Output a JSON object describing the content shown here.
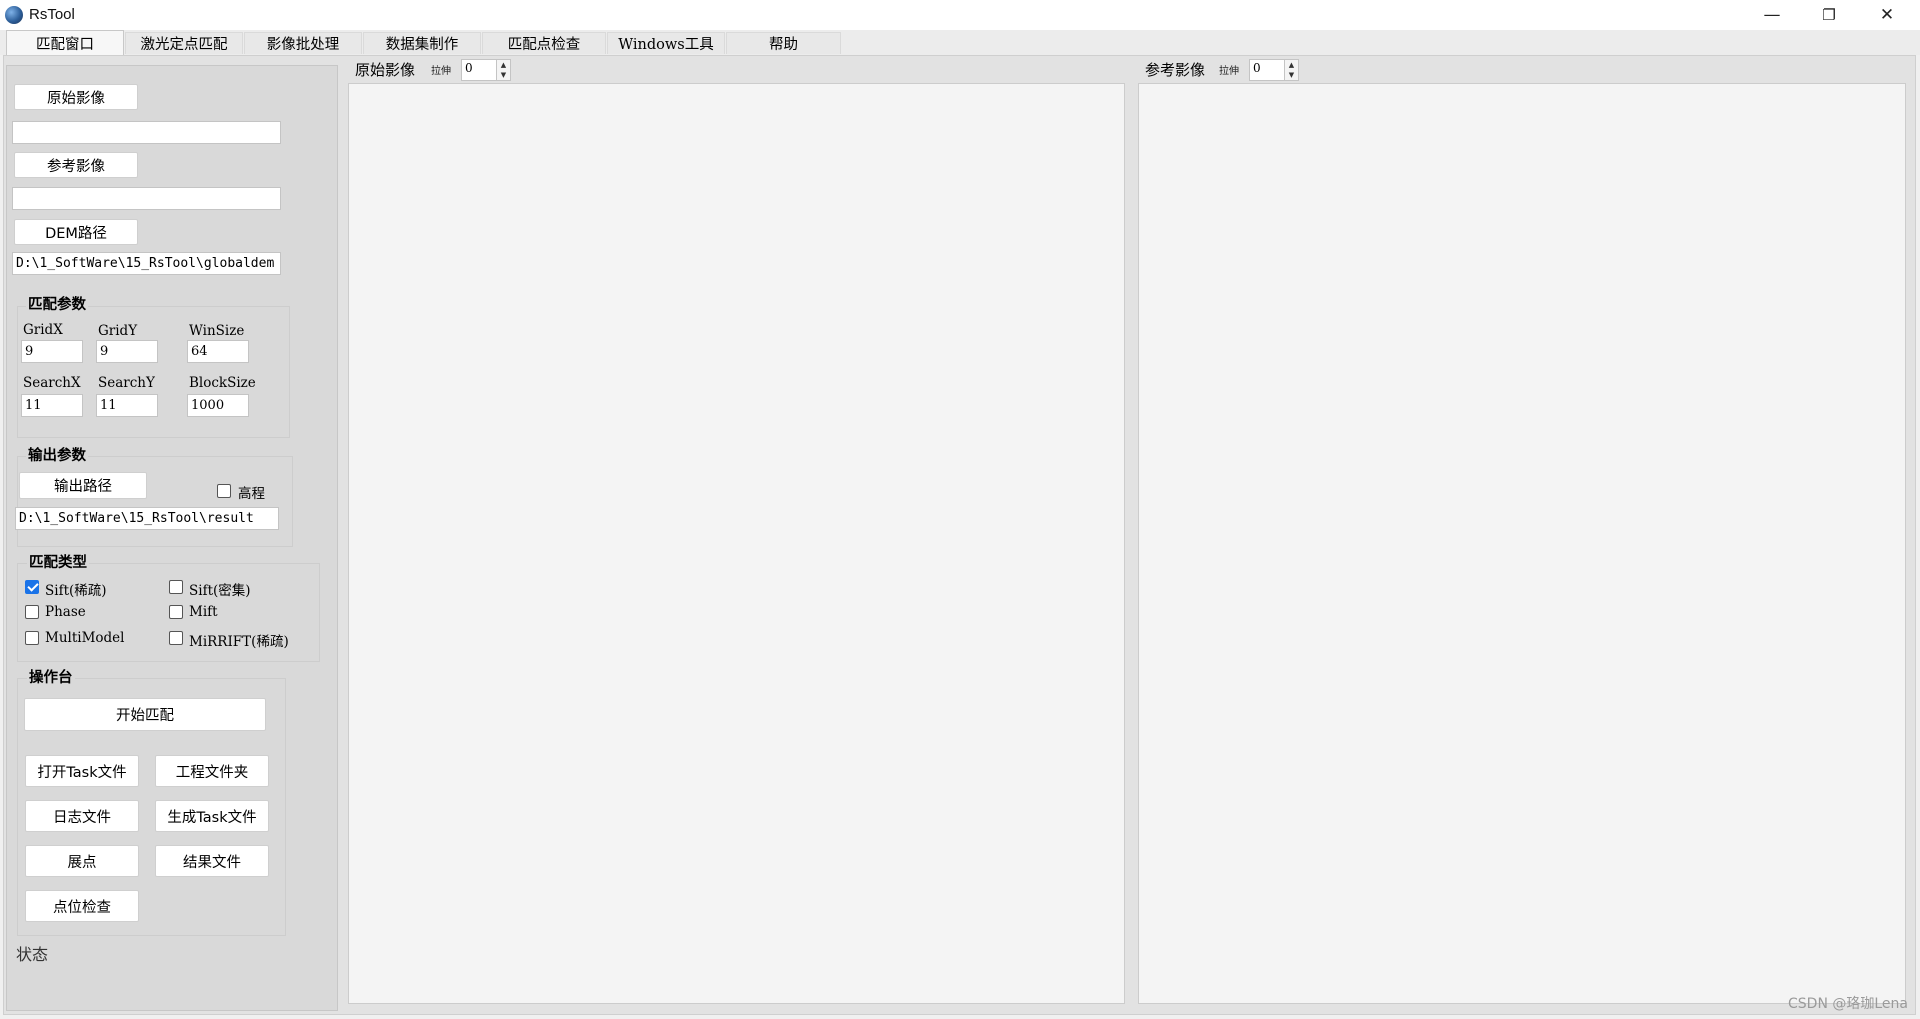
{
  "window": {
    "title": "RsTool",
    "controls": {
      "minimize": "—",
      "restore": "❐",
      "close": "✕"
    }
  },
  "tabs": [
    {
      "label": "匹配窗口",
      "active": true
    },
    {
      "label": "激光定点匹配"
    },
    {
      "label": "影像批处理"
    },
    {
      "label": "数据集制作"
    },
    {
      "label": "匹配点检查"
    },
    {
      "label": "Windows工具"
    },
    {
      "label": "帮助"
    }
  ],
  "input": {
    "src_button": "原始影像",
    "src_path": "",
    "ref_button": "参考影像",
    "ref_path": "",
    "dem_button": "DEM路径",
    "dem_path": "D:\\1_SoftWare\\15_RsTool\\globaldem"
  },
  "match_params": {
    "title": "匹配参数",
    "gridx_label": "GridX",
    "gridx": "9",
    "gridy_label": "GridY",
    "gridy": "9",
    "winsize_label": "WinSize",
    "winsize": "64",
    "searchx_label": "SearchX",
    "searchx": "11",
    "searchy_label": "SearchY",
    "searchy": "11",
    "blocksize_label": "BlockSize",
    "blocksize": "1000"
  },
  "output_params": {
    "title": "输出参数",
    "path_button": "输出路径",
    "elevation_label": "高程",
    "elevation_checked": false,
    "path": "D:\\1_SoftWare\\15_RsTool\\result"
  },
  "match_type": {
    "title": "匹配类型",
    "options": [
      {
        "label": "Sift(稀疏)",
        "checked": true
      },
      {
        "label": "Sift(密集)",
        "checked": false
      },
      {
        "label": "Phase",
        "checked": false
      },
      {
        "label": "Mift",
        "checked": false
      },
      {
        "label": "MultiModel",
        "checked": false
      },
      {
        "label": "MiRRIFT(稀疏)",
        "checked": false
      }
    ]
  },
  "console": {
    "title": "操作台",
    "start": "开始匹配",
    "open_task": "打开Task文件",
    "project_folder": "工程文件夹",
    "log_file": "日志文件",
    "gen_task": "生成Task文件",
    "show_points": "展点",
    "result_file": "结果文件",
    "check_points": "点位检查"
  },
  "status_label": "状态",
  "viewers": {
    "source": {
      "title": "原始影像",
      "stretch_label": "拉伸",
      "stretch_value": "0"
    },
    "reference": {
      "title": "参考影像",
      "stretch_label": "拉伸",
      "stretch_value": "0"
    }
  },
  "watermark": "CSDN @珞珈Lena"
}
